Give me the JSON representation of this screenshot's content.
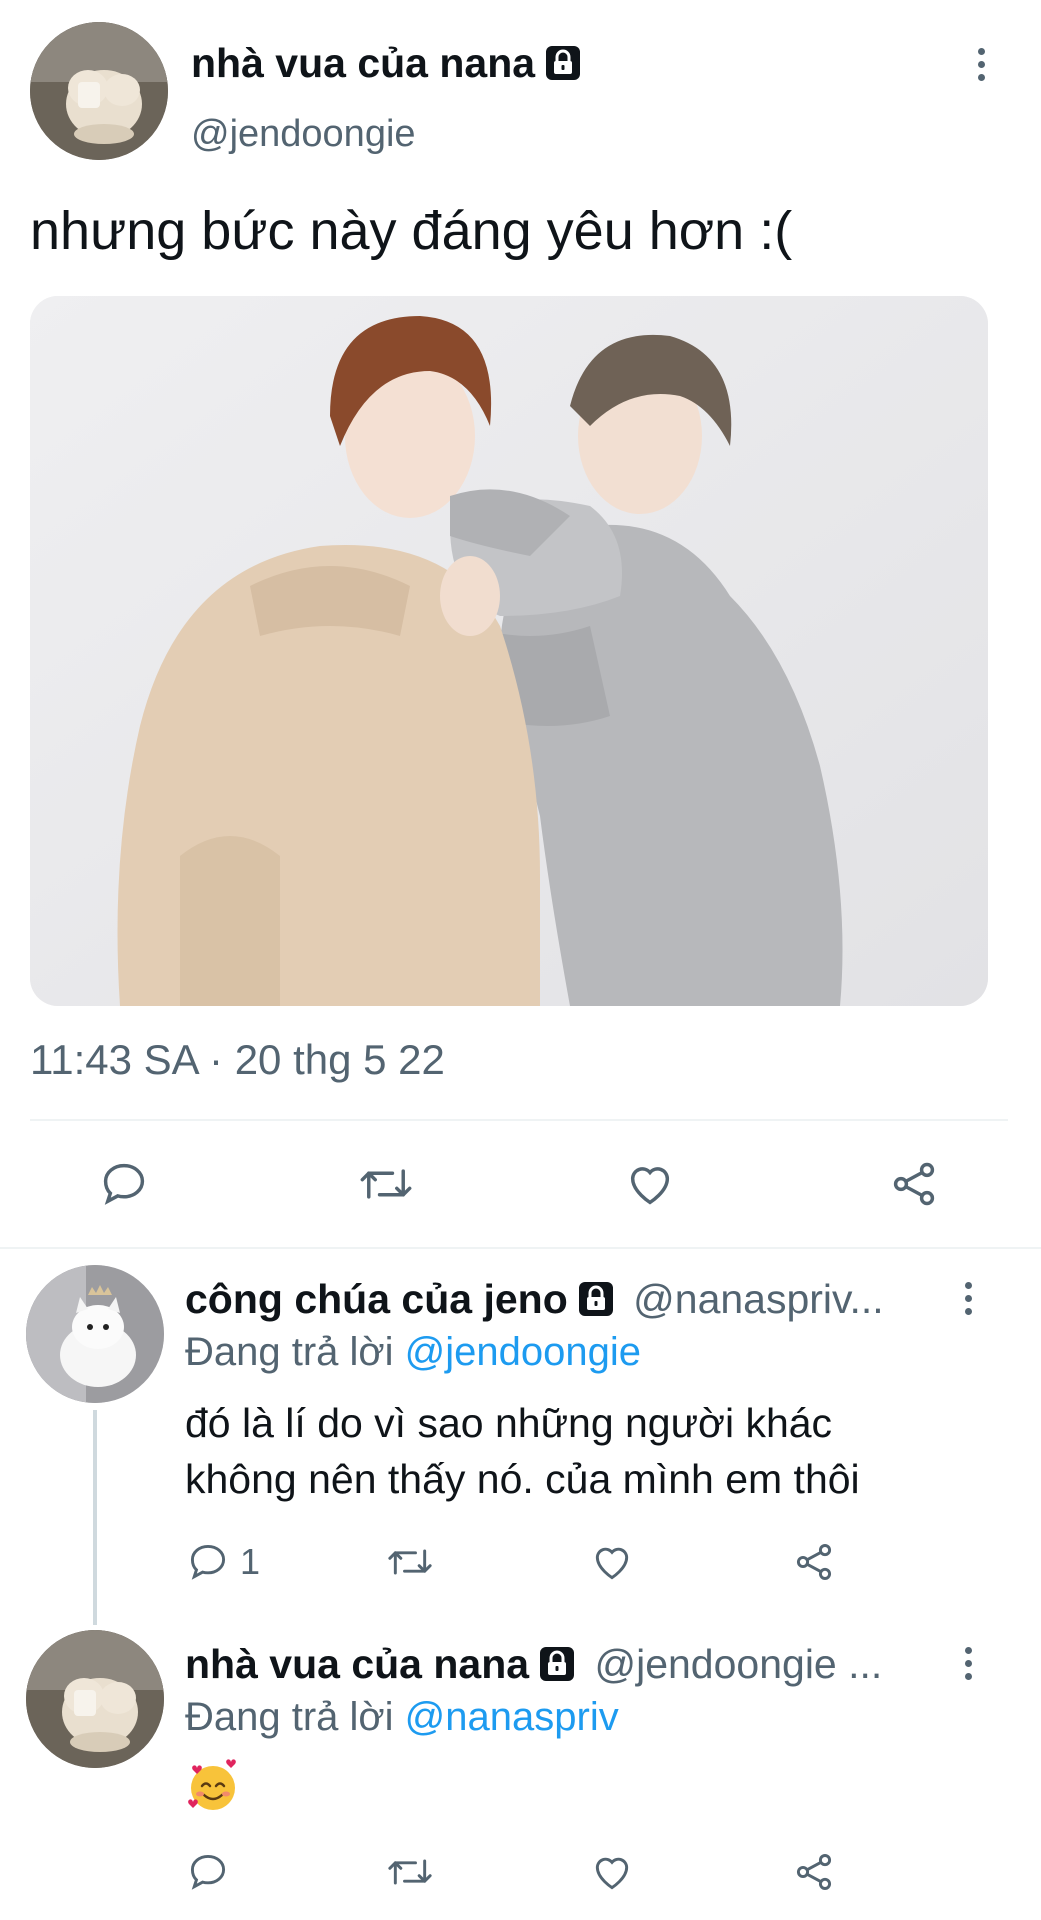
{
  "tweet": {
    "author_name": "nhà vua của nana",
    "author_handle": "@jendoongie",
    "text": "nhưng bức này đáng yêu hơn :(",
    "timestamp": "11:43 SA · 20 thg 5 22"
  },
  "replies": [
    {
      "author_name": "công chúa của jeno",
      "author_handle": "@nanaspriv...",
      "replying_prefix": "Đang trả lời",
      "replying_to": "@jendoongie",
      "text_line1": "đó là lí do vì sao những người khác",
      "text_line2": "không nên thấy nó. của mình em thôi",
      "reply_count": "1"
    },
    {
      "author_name": "nhà vua của nana",
      "author_handle": "@jendoongie ...",
      "replying_prefix": "Đang trả lời",
      "replying_to": "@nanaspriv",
      "text": "🥰"
    }
  ],
  "icons": {
    "reply": "reply-icon",
    "retweet": "retweet-icon",
    "like": "heart-icon",
    "share": "share-icon",
    "more": "more-vertical-icon",
    "lock": "lock-icon"
  },
  "colors": {
    "text": "#0f1419",
    "muted": "#536471",
    "link": "#1d9bf0",
    "divider": "#eff3f4"
  }
}
